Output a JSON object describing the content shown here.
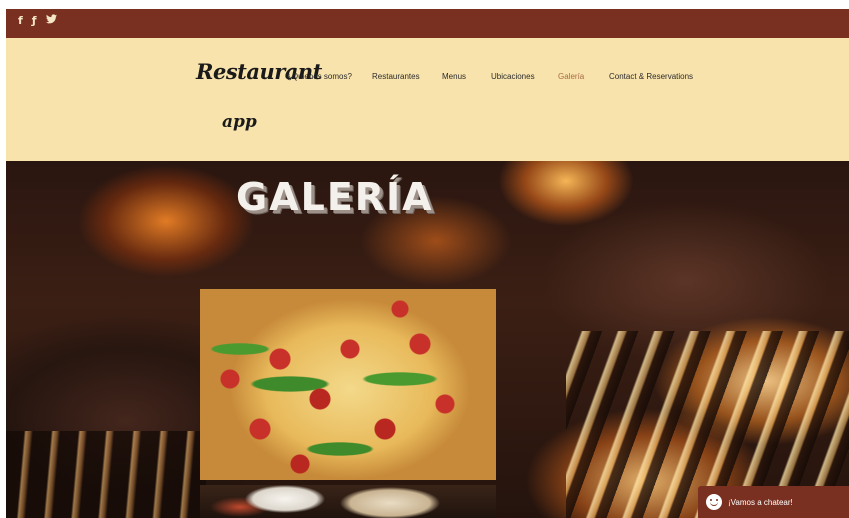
{
  "social": {
    "facebook": "f",
    "foursquare": "ƒ",
    "twitter": "🐦",
    "instagram_icon": "instagram-icon"
  },
  "brand": {
    "line1": "Restaurant",
    "line2": "app"
  },
  "nav": {
    "items": [
      {
        "label": "¿Quienes somos?",
        "active": false
      },
      {
        "label": "Restaurantes",
        "active": false
      },
      {
        "label": "Menus",
        "active": false
      },
      {
        "label": "Ubicaciones",
        "active": false
      },
      {
        "label": "Galería",
        "active": true
      },
      {
        "label": "Contact & Reservations",
        "active": false
      }
    ]
  },
  "hero": {
    "title": "GALERÍA"
  },
  "gallery": {
    "images": [
      "pizza-photo",
      "plate-photo"
    ]
  },
  "chat": {
    "label": "¡Vamos a chatear!"
  },
  "colors": {
    "topbar": "#7a3020",
    "nav_background": "#f8e3ad",
    "active_link": "#a76b45"
  }
}
